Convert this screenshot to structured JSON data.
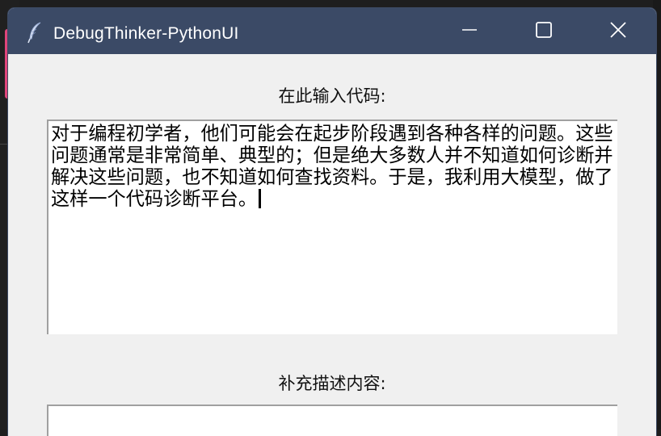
{
  "window": {
    "title": "DebugThinker-PythonUI",
    "app_icon": "feather-icon",
    "controls": [
      "minimize-icon",
      "maximize-icon",
      "close-icon"
    ],
    "titlebar_color": "#3b4a66"
  },
  "main": {
    "code_label": "在此输入代码:",
    "code_value": "对于编程初学者，他们可能会在起步阶段遇到各种各样的问题。这些问题通常是非常简单、典型的；但是绝大多数人并不知道如何诊断并解决这些问题，也不知道如何查找资料。于是，我利用大模型，做了这样一个代码诊断平台。",
    "desc_label": "补充描述内容:",
    "desc_value": ""
  }
}
